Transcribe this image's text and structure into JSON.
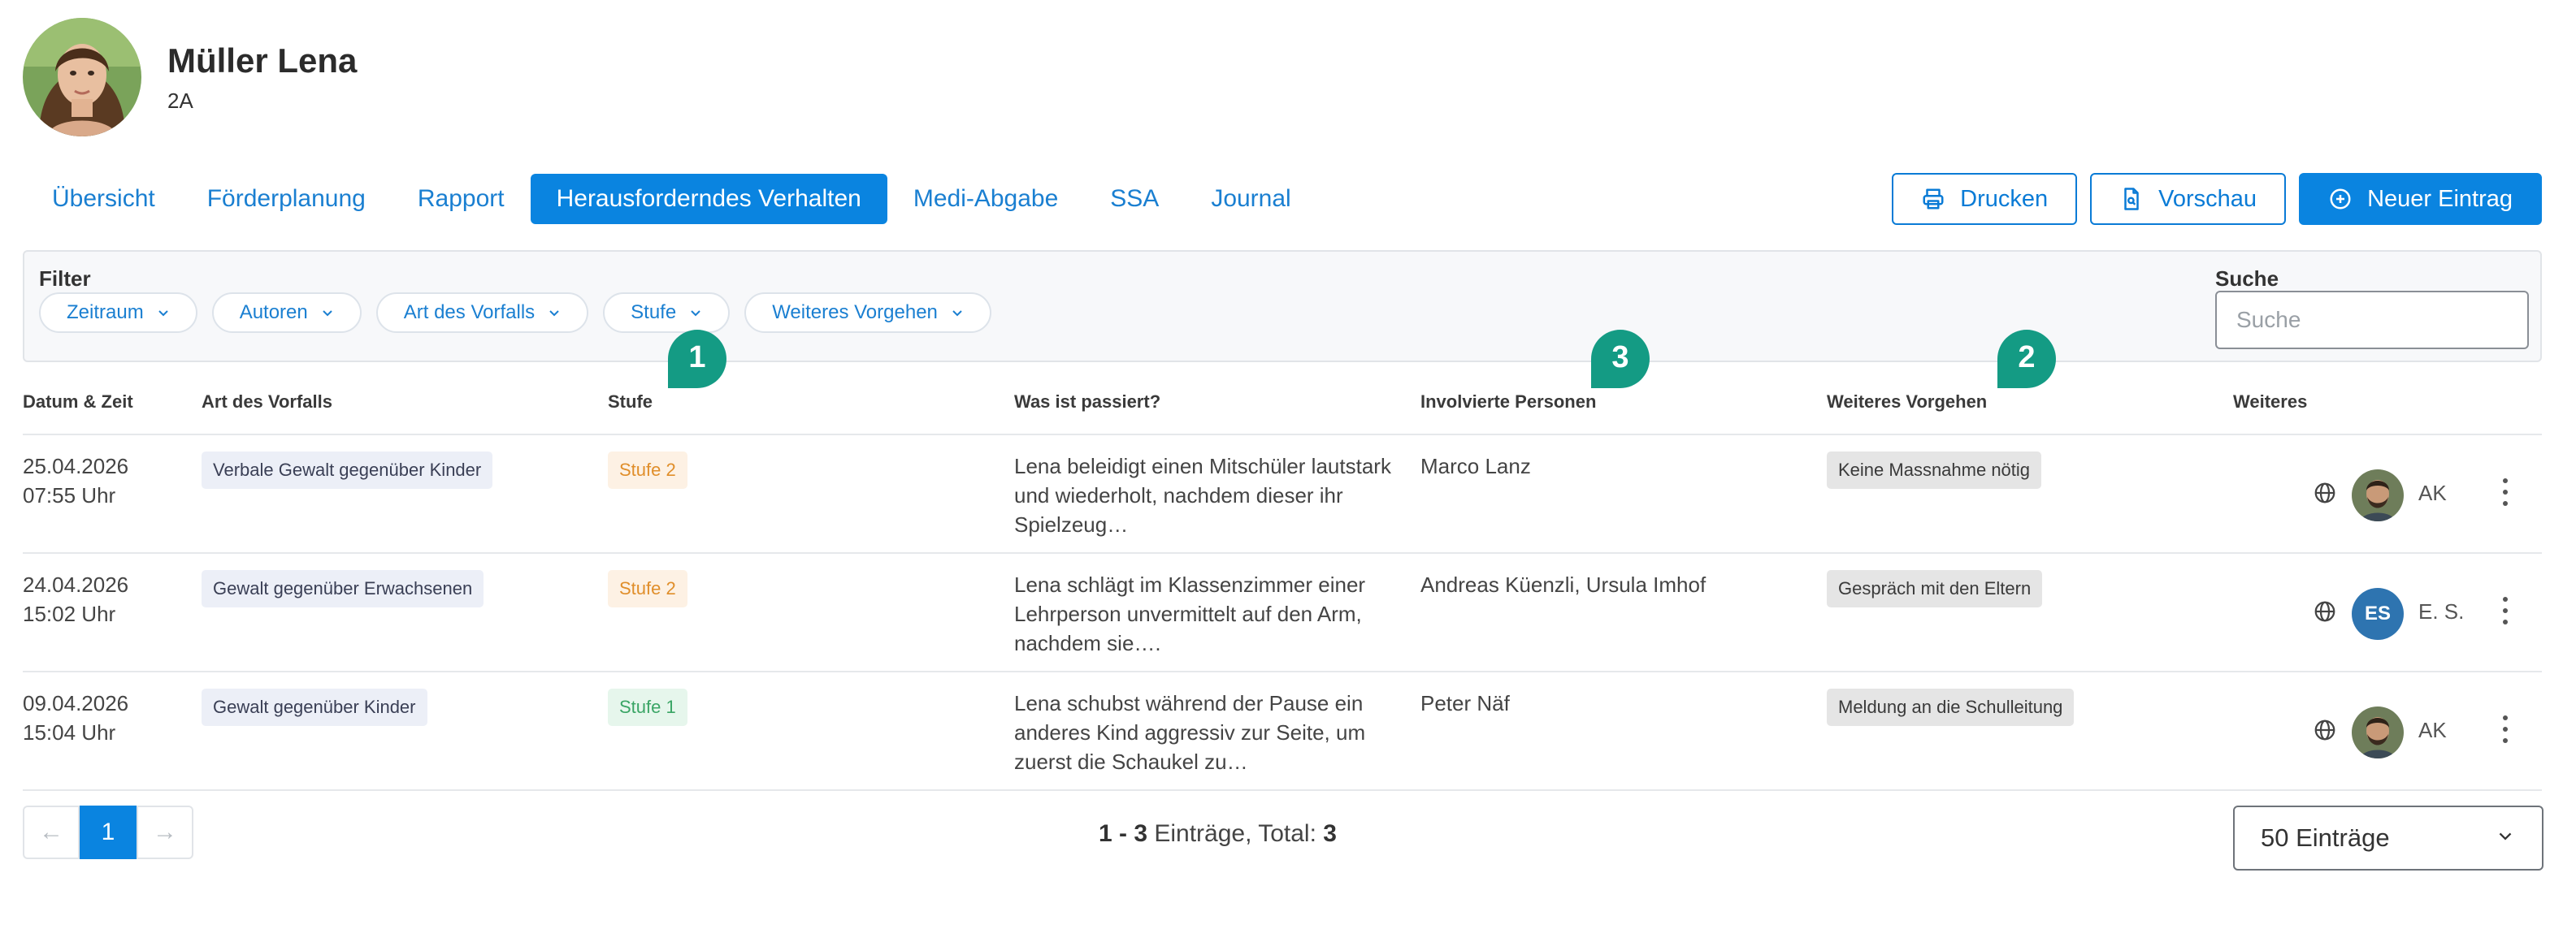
{
  "student": {
    "name": "Müller Lena",
    "class": "2A"
  },
  "tabs": [
    {
      "label": "Übersicht"
    },
    {
      "label": "Förderplanung"
    },
    {
      "label": "Rapport"
    },
    {
      "label": "Herausforderndes Verhalten",
      "active": true
    },
    {
      "label": "Medi-Abgabe"
    },
    {
      "label": "SSA"
    },
    {
      "label": "Journal"
    }
  ],
  "actions": {
    "print": "Drucken",
    "preview": "Vorschau",
    "new_entry": "Neuer Eintrag"
  },
  "filter": {
    "label": "Filter",
    "chips": [
      "Zeitraum",
      "Autoren",
      "Art des Vorfalls",
      "Stufe",
      "Weiteres Vorgehen"
    ],
    "search_label": "Suche",
    "search_placeholder": "Suche"
  },
  "markers": [
    "1",
    "3",
    "2"
  ],
  "table": {
    "headers": [
      "Datum & Zeit",
      "Art des Vorfalls",
      "Stufe",
      "Was ist passiert?",
      "Involvierte Personen",
      "Weiteres Vorgehen",
      "Weiteres"
    ],
    "rows": [
      {
        "date": "25.04.2026",
        "time": "07:55 Uhr",
        "art": "Verbale Gewalt gegenüber Kinder",
        "stufe": "Stufe 2",
        "what": "Lena beleidigt einen Mitschüler lautstark und wiederholt, nachdem dieser ihr Spielzeug…",
        "persons": "Marco Lanz",
        "vorgehen": "Keine Massnahme nötig",
        "author": "AK"
      },
      {
        "date": "24.04.2026",
        "time": "15:02 Uhr",
        "art": "Gewalt gegenüber Erwachsenen",
        "stufe": "Stufe 2",
        "what": "Lena schlägt im Klassenzimmer einer Lehrperson unvermittelt auf den Arm, nachdem sie….",
        "persons": "Andreas Küenzli, Ursula Imhof",
        "vorgehen": "Gespräch mit den Eltern",
        "author_initials": "ES",
        "author": "E. S."
      },
      {
        "date": "09.04.2026",
        "time": "15:04 Uhr",
        "art": "Gewalt gegenüber Kinder",
        "stufe": "Stufe 1",
        "what": "Lena schubst während der Pause ein anderes Kind aggressiv zur Seite, um zuerst die Schaukel zu…",
        "persons": "Peter Näf",
        "vorgehen": "Meldung an die Schulleitung",
        "author": "AK"
      }
    ]
  },
  "pagination": {
    "prev": "←",
    "current": "1",
    "next": "→",
    "range": "1 - 3",
    "entries_word": " Einträge, Total: ",
    "total": "3",
    "per_page": "50 Einträge"
  },
  "colors": {
    "accent": "#0a84e0",
    "marker": "#149b84"
  }
}
